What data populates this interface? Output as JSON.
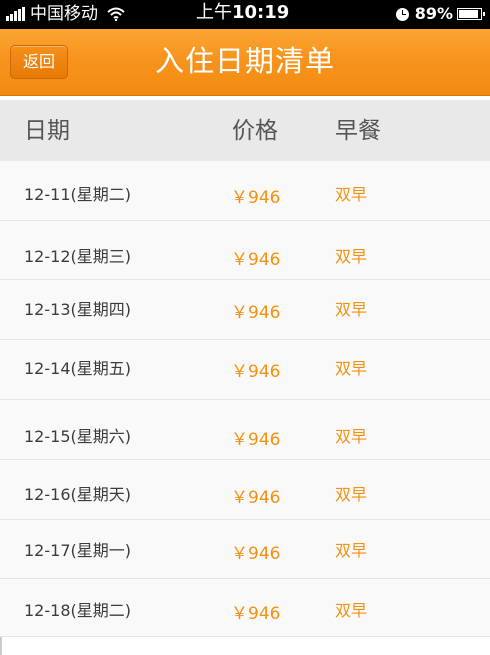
{
  "status_bar": {
    "carrier": "中国移动",
    "time_prefix": "上午",
    "time": "10:19",
    "battery_percent": "89%",
    "battery_level": 0.89
  },
  "nav": {
    "back_label": "返回",
    "title": "入住日期清单"
  },
  "table": {
    "headers": {
      "date": "日期",
      "price": "价格",
      "breakfast": "早餐"
    },
    "rows": [
      {
        "date": "12-11(星期二)",
        "price": "￥946",
        "breakfast": "双早"
      },
      {
        "date": "12-12(星期三)",
        "price": "￥946",
        "breakfast": "双早"
      },
      {
        "date": "12-13(星期四)",
        "price": "￥946",
        "breakfast": "双早"
      },
      {
        "date": "12-14(星期五)",
        "price": "￥946",
        "breakfast": "双早"
      },
      {
        "date": "12-15(星期六)",
        "price": "￥946",
        "breakfast": "双早"
      },
      {
        "date": "12-16(星期天)",
        "price": "￥946",
        "breakfast": "双早"
      },
      {
        "date": "12-17(星期一)",
        "price": "￥946",
        "breakfast": "双早"
      },
      {
        "date": "12-18(星期二)",
        "price": "￥946",
        "breakfast": "双早"
      }
    ]
  },
  "colors": {
    "accent": "#f7941e",
    "price_text": "#f39112",
    "header_bg": "#e9e9e9"
  }
}
